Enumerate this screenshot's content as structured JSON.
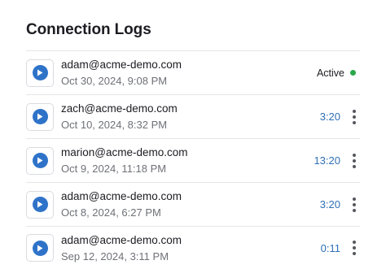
{
  "page": {
    "title": "Connection Logs"
  },
  "colors": {
    "accent": "#2f73c9",
    "duration_text": "#2f6fb5",
    "active_dot": "#2aa84a"
  },
  "logs": [
    {
      "email": "adam@acme-demo.com",
      "date": "Oct 30, 2024, 9:08 PM",
      "status": "Active",
      "duration": null
    },
    {
      "email": "zach@acme-demo.com",
      "date": "Oct 10, 2024, 8:32 PM",
      "status": null,
      "duration": "3:20"
    },
    {
      "email": "marion@acme-demo.com",
      "date": "Oct 9, 2024, 11:18 PM",
      "status": null,
      "duration": "13:20"
    },
    {
      "email": "adam@acme-demo.com",
      "date": "Oct 8, 2024, 6:27 PM",
      "status": null,
      "duration": "3:20"
    },
    {
      "email": "adam@acme-demo.com",
      "date": "Sep 12, 2024, 3:11 PM",
      "status": null,
      "duration": "0:11"
    }
  ],
  "icons": {
    "play": "play-icon",
    "more": "more-vertical-icon",
    "status": "status-dot-icon"
  }
}
